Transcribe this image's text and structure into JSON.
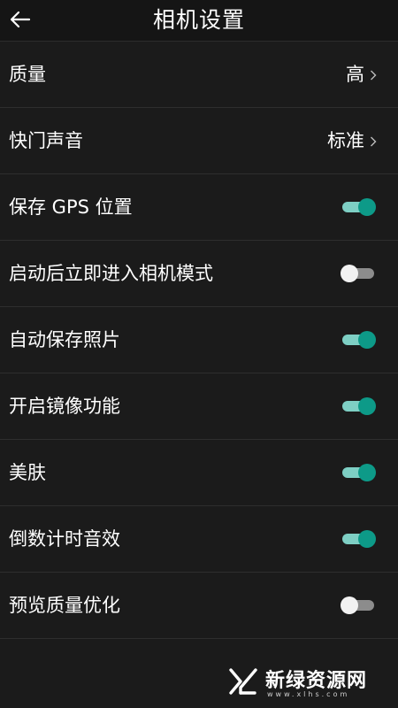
{
  "header": {
    "title": "相机设置",
    "back_icon": "arrow-left-icon"
  },
  "settings": [
    {
      "label": "质量",
      "type": "value",
      "value": "高"
    },
    {
      "label": "快门声音",
      "type": "value",
      "value": "标准"
    },
    {
      "label": "保存 GPS 位置",
      "type": "toggle",
      "on": true
    },
    {
      "label": "启动后立即进入相机模式",
      "type": "toggle",
      "on": false
    },
    {
      "label": "自动保存照片",
      "type": "toggle",
      "on": true
    },
    {
      "label": "开启镜像功能",
      "type": "toggle",
      "on": true
    },
    {
      "label": "美肤",
      "type": "toggle",
      "on": true
    },
    {
      "label": "倒数计时音效",
      "type": "toggle",
      "on": true
    },
    {
      "label": "预览质量优化",
      "type": "toggle",
      "on": false
    }
  ],
  "watermark": {
    "text": "新绿资源网",
    "sub": "www.xlhs.com"
  },
  "colors": {
    "background": "#1b1b1b",
    "toggle_on_knob": "#0d9a88",
    "toggle_on_track": "#7ecfc4",
    "toggle_off_knob": "#f2f2f2",
    "toggle_off_track": "#8c8c8c"
  }
}
